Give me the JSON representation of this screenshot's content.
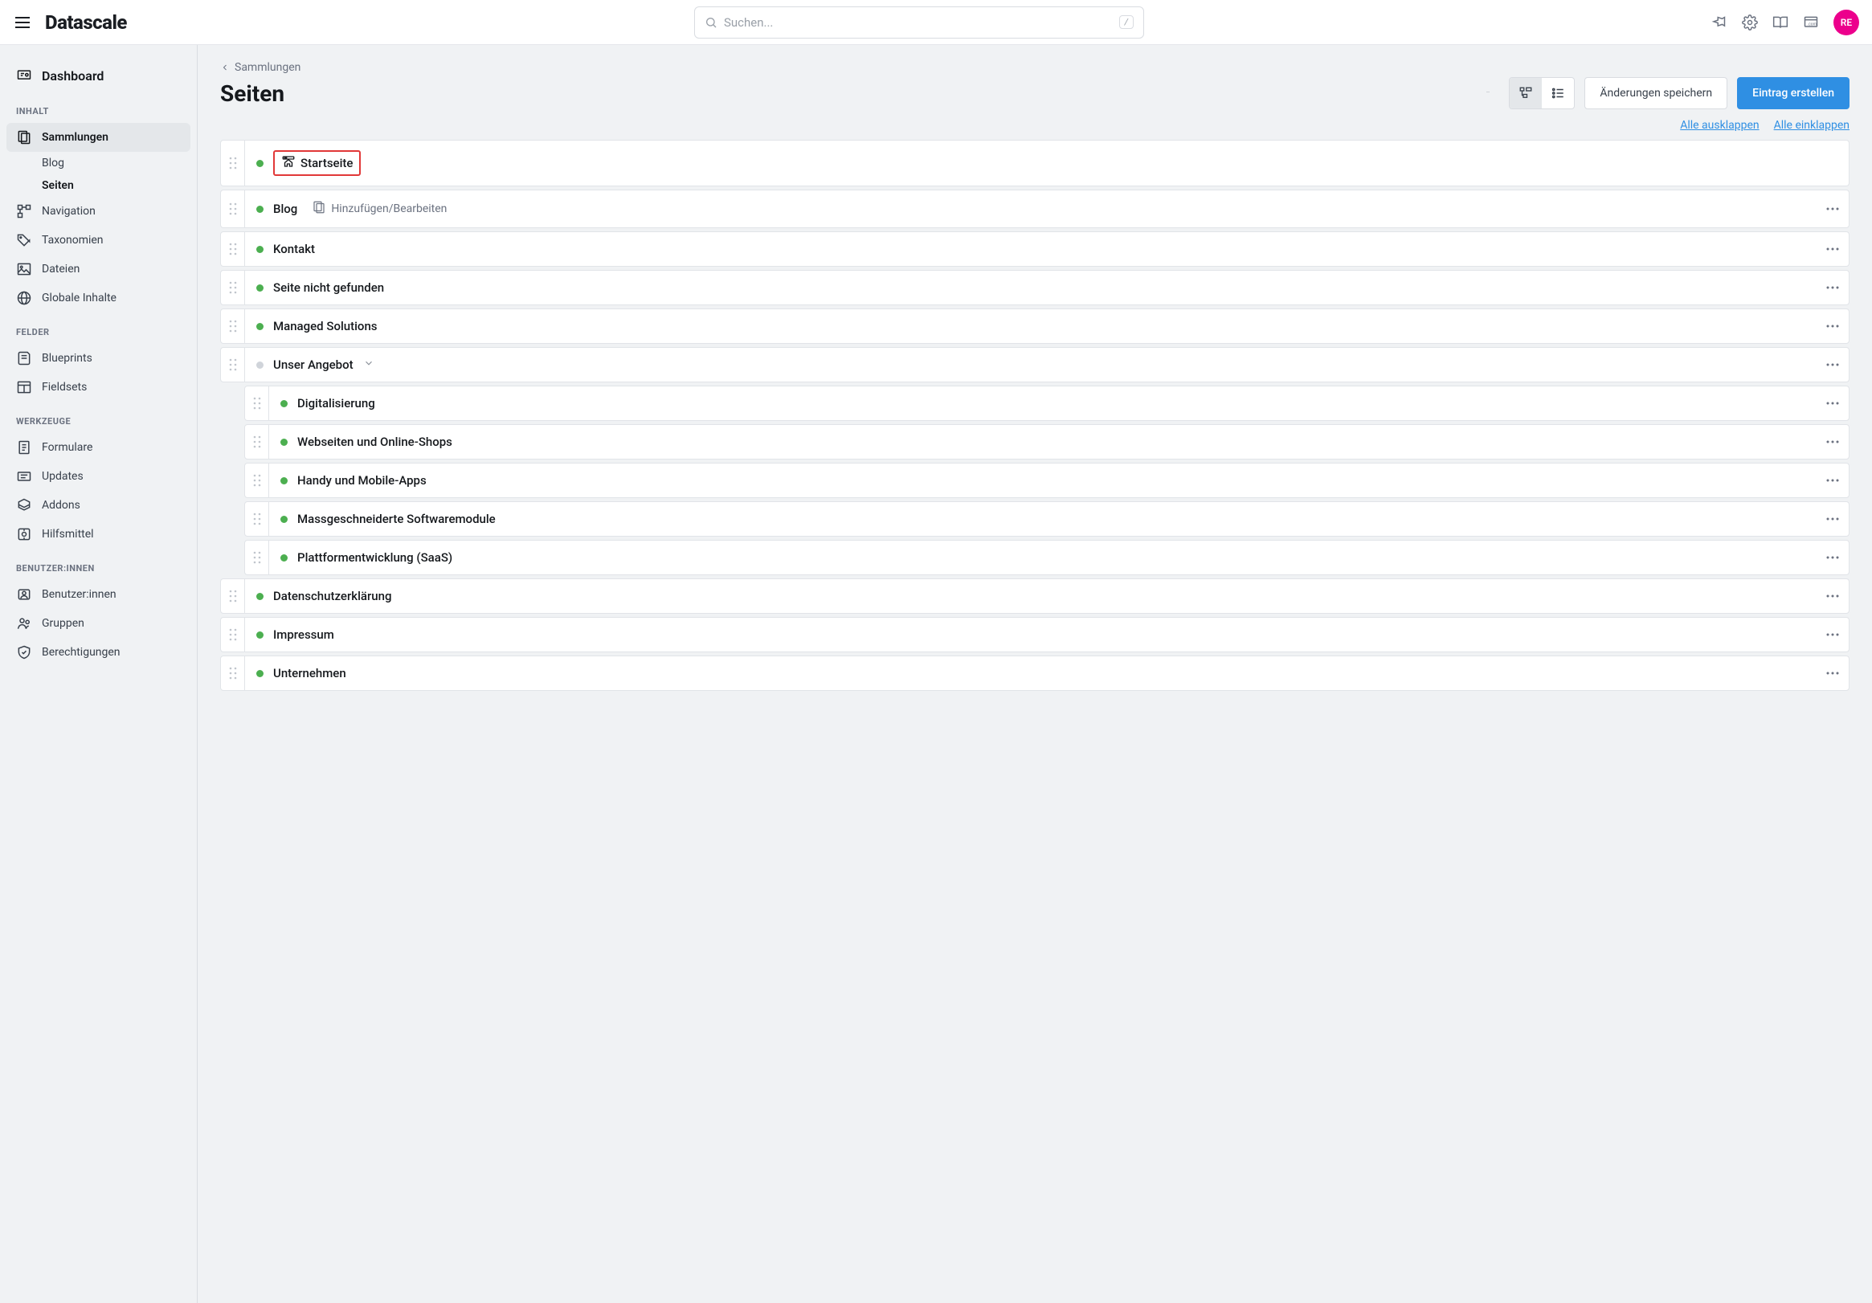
{
  "topbar": {
    "logo": "Datascale",
    "search_placeholder": "Suchen...",
    "kbd_hint": "/",
    "avatar_initials": "RE"
  },
  "sidebar": {
    "dashboard": "Dashboard",
    "sections": {
      "inhalt": "INHALT",
      "felder": "FELDER",
      "werkzeuge": "WERKZEUGE",
      "benutzer": "BENUTZER:INNEN"
    },
    "items": {
      "sammlungen": "Sammlungen",
      "blog": "Blog",
      "seiten": "Seiten",
      "navigation": "Navigation",
      "taxonomien": "Taxonomien",
      "dateien": "Dateien",
      "globale": "Globale Inhalte",
      "blueprints": "Blueprints",
      "fieldsets": "Fieldsets",
      "formulare": "Formulare",
      "updates": "Updates",
      "addons": "Addons",
      "hilfsmittel": "Hilfsmittel",
      "benutzer": "Benutzer:innen",
      "gruppen": "Gruppen",
      "berechtigungen": "Berechtigungen"
    }
  },
  "main": {
    "breadcrumb": "Sammlungen",
    "title": "Seiten",
    "save_btn": "Änderungen speichern",
    "create_btn": "Eintrag erstellen",
    "expand_all": "Alle ausklappen",
    "collapse_all": "Alle einklappen",
    "add_edit": "Hinzufügen/Bearbeiten"
  },
  "pages": [
    {
      "title": "Startseite",
      "home": true,
      "status": "green"
    },
    {
      "title": "Blog",
      "addedit": true,
      "status": "green",
      "more": true
    },
    {
      "title": "Kontakt",
      "status": "green",
      "more": true
    },
    {
      "title": "Seite nicht gefunden",
      "status": "green",
      "more": true
    },
    {
      "title": "Managed Solutions",
      "status": "green",
      "more": true
    },
    {
      "title": "Unser Angebot",
      "status": "grey",
      "expandable": true,
      "more": true,
      "children": [
        {
          "title": "Digitalisierung",
          "status": "green",
          "more": true
        },
        {
          "title": "Webseiten und Online-Shops",
          "status": "green",
          "more": true
        },
        {
          "title": "Handy und Mobile-Apps",
          "status": "green",
          "more": true
        },
        {
          "title": "Massgeschneiderte Softwaremodule",
          "status": "green",
          "more": true
        },
        {
          "title": "Plattformentwicklung (SaaS)",
          "status": "green",
          "more": true
        }
      ]
    },
    {
      "title": "Datenschutzerklärung",
      "status": "green",
      "more": true
    },
    {
      "title": "Impressum",
      "status": "green",
      "more": true
    },
    {
      "title": "Unternehmen",
      "status": "green",
      "more": true
    }
  ]
}
